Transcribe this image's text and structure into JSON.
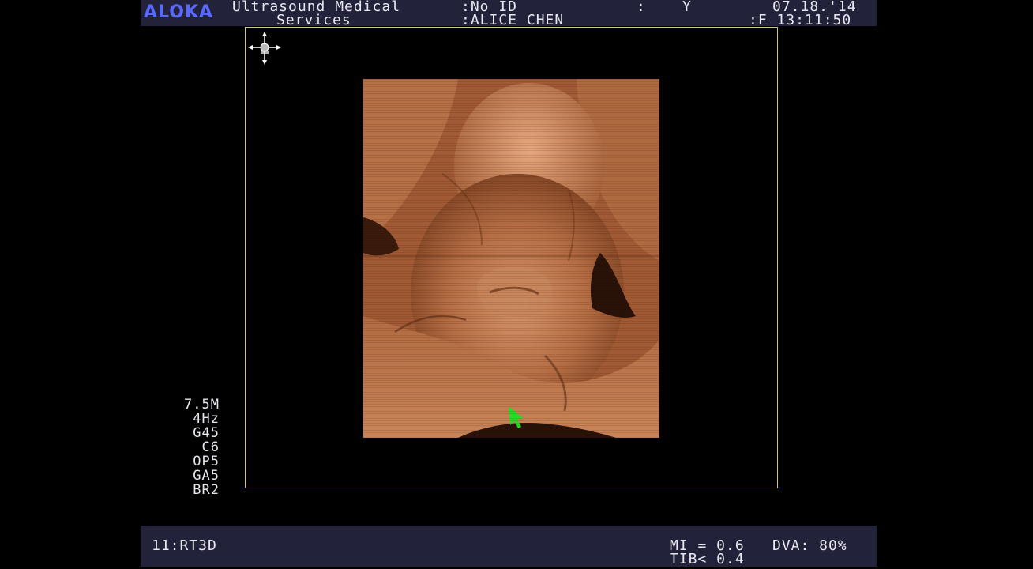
{
  "header": {
    "brand": "ALOKA",
    "institution_line1": "Ultrasound Medical",
    "institution_line2": "Services",
    "patient_id": ":No ID",
    "patient_name": ":ALICE CHEN",
    "sep_mark": ":",
    "sex_mark": "Y",
    "date": "07.18.'14",
    "time": ":F 13:11:50"
  },
  "params": [
    "7.5M",
    "4Hz",
    "G45",
    "C6",
    "OP5",
    "GA5",
    "BR2"
  ],
  "footer": {
    "mode": "11:RT3D",
    "mi": "MI = 0.6",
    "dva": "DVA: 80%",
    "tib": "TIB< 0.4"
  },
  "colors": {
    "bar_bg": "#22223a",
    "brand": "#5a68ff",
    "frame": "#cfc47a",
    "render_tone": "#a85f36",
    "cursor": "#22dd22"
  },
  "icons": {
    "crosshair": "crosshair-icon",
    "cursor": "arrow-cursor-icon"
  }
}
